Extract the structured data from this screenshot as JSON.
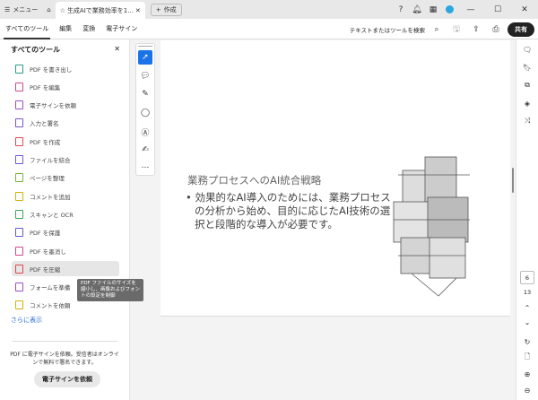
{
  "titlebar": {
    "menu": "メニュー",
    "tab_title": "生成AIで業務効率を1...",
    "new": "作成"
  },
  "menubar": {
    "tabs": [
      "すべてのツール",
      "編集",
      "変換",
      "電子サイン"
    ],
    "search": "テキストまたはツールを検索",
    "share": "共有"
  },
  "panel": {
    "title": "すべてのツール",
    "tools": [
      {
        "label": "PDF を書き出し",
        "color": "#2b9a8a"
      },
      {
        "label": "PDF を編集",
        "color": "#d0488f"
      },
      {
        "label": "電子サインを依頼",
        "color": "#9b4fc9"
      },
      {
        "label": "入力と署名",
        "color": "#7a55d1"
      },
      {
        "label": "PDF を作成",
        "color": "#e0474c"
      },
      {
        "label": "ファイルを結合",
        "color": "#6b5bd6"
      },
      {
        "label": "ページを整理",
        "color": "#7cb342"
      },
      {
        "label": "コメントを追加",
        "color": "#d4b106"
      },
      {
        "label": "スキャンと OCR",
        "color": "#3aa857"
      },
      {
        "label": "PDF を保護",
        "color": "#5c5ccc"
      },
      {
        "label": "PDF を墨消し",
        "color": "#d0488f"
      },
      {
        "label": "PDF を圧縮",
        "color": "#e0474c"
      },
      {
        "label": "フォームを準備",
        "color": "#9b4fc9"
      },
      {
        "label": "コメントを依頼",
        "color": "#d4b106"
      }
    ],
    "more": "さらに表示",
    "promo_text": "PDF に電子サインを依頼。受信者はオンラインで無料で署名できます。",
    "promo_button": "電子サインを依頼",
    "tooltip": "PDF ファイルのサイズを縮小し、画像およびフォントの設定を制御"
  },
  "slide": {
    "title": "業務プロセスへのAI統合戦略",
    "bullet": "• 効果的なAI導入のためには、業務プロセスの分析から始め、目的に応じたAI技術の選択と段階的な導入が必要です。"
  },
  "nav": {
    "current_page": "6",
    "total_pages": "13"
  }
}
